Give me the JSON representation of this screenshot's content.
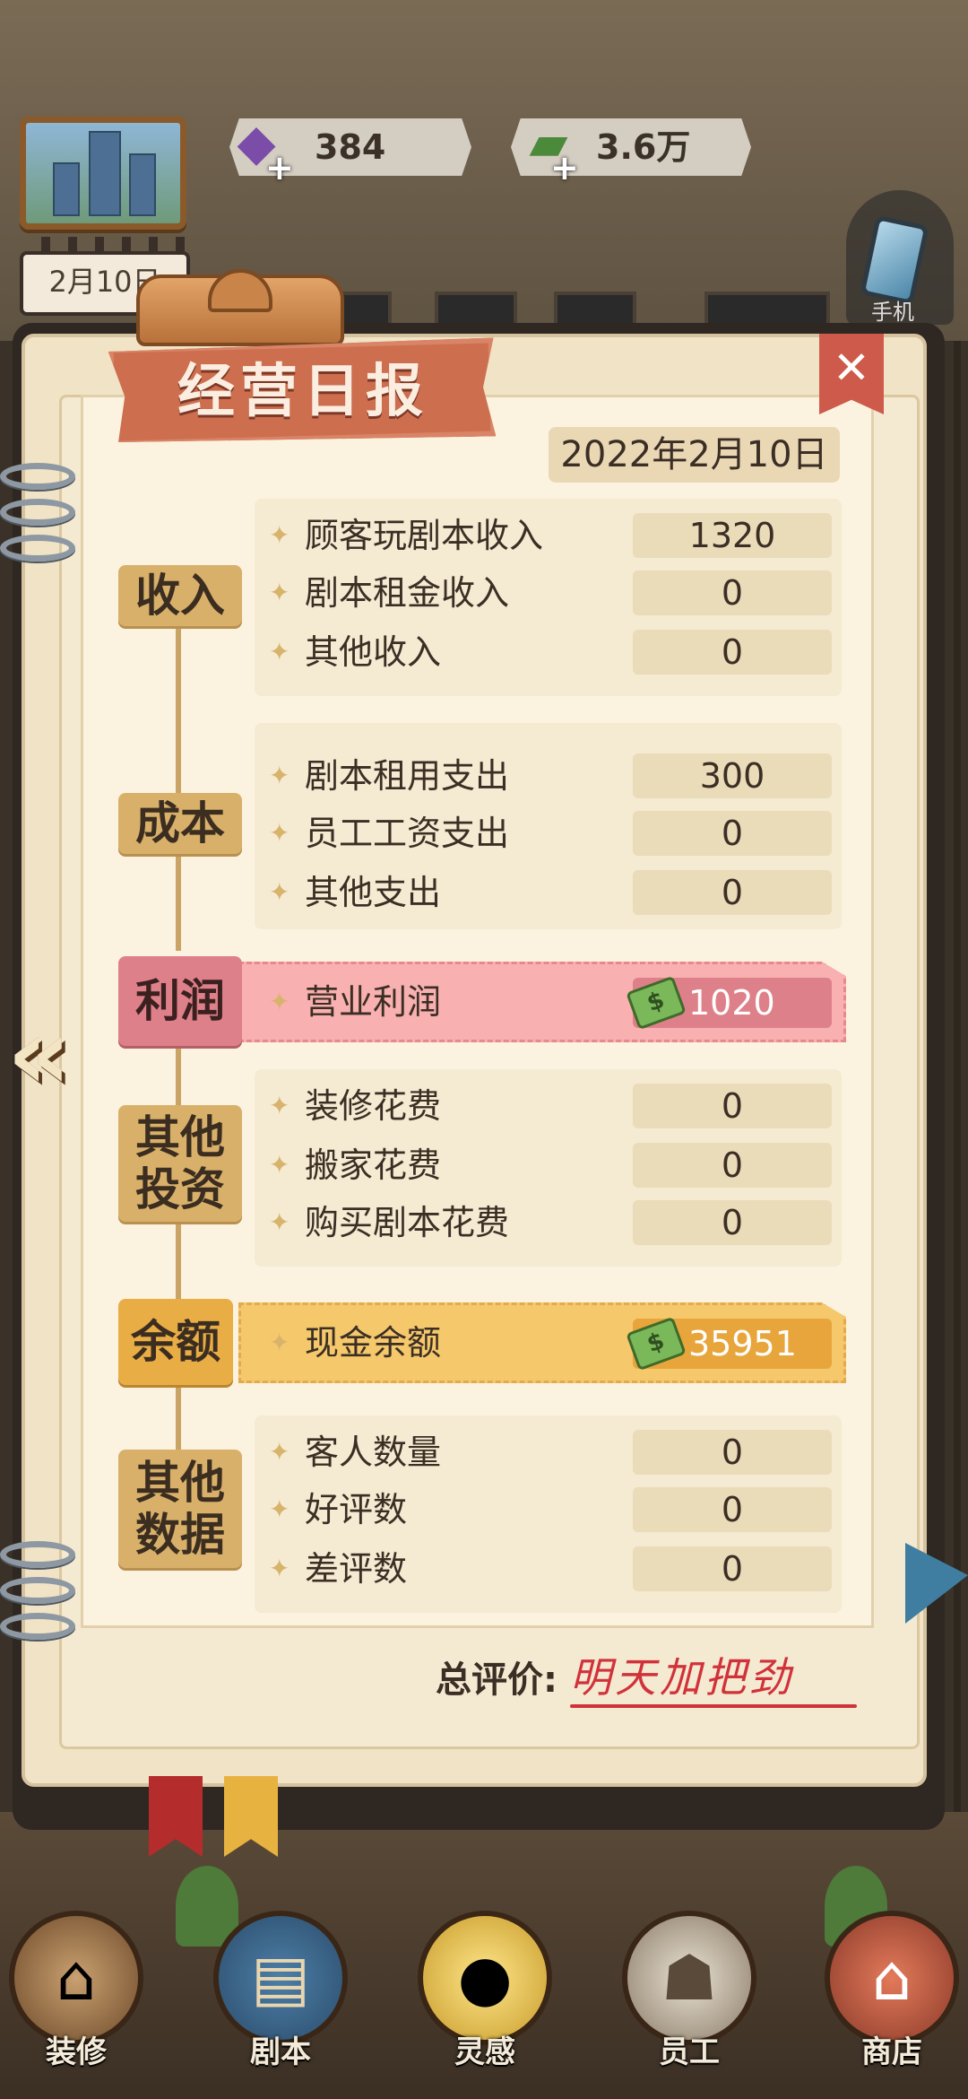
{
  "hud": {
    "gems": "384",
    "cash": "3.6万",
    "calendar_date": "2月10日",
    "phone_label": "手机"
  },
  "report": {
    "title": "经营日报",
    "date": "2022年2月10日",
    "close_icon": "✕",
    "sections": {
      "income": {
        "label": "收入",
        "rows": [
          {
            "label": "顾客玩剧本收入",
            "value": "1320"
          },
          {
            "label": "剧本租金收入",
            "value": "0"
          },
          {
            "label": "其他收入",
            "value": "0"
          }
        ]
      },
      "cost": {
        "label": "成本",
        "rows": [
          {
            "label": "剧本租用支出",
            "value": "300"
          },
          {
            "label": "员工工资支出",
            "value": "0"
          },
          {
            "label": "其他支出",
            "value": "0"
          }
        ]
      },
      "profit": {
        "label": "利润",
        "row": {
          "label": "营业利润",
          "value": "1020"
        }
      },
      "investment": {
        "label_line1": "其他",
        "label_line2": "投资",
        "rows": [
          {
            "label": "装修花费",
            "value": "0"
          },
          {
            "label": "搬家花费",
            "value": "0"
          },
          {
            "label": "购买剧本花费",
            "value": "0"
          }
        ]
      },
      "balance": {
        "label": "余额",
        "row": {
          "label": "现金余额",
          "value": "35951"
        }
      },
      "other_data": {
        "label_line1": "其他",
        "label_line2": "数据",
        "rows": [
          {
            "label": "客人数量",
            "value": "0"
          },
          {
            "label": "好评数",
            "value": "0"
          },
          {
            "label": "差评数",
            "value": "0"
          }
        ]
      }
    },
    "rating_label": "总评价:",
    "rating_value": "明天加把劲"
  },
  "bottom_nav": [
    {
      "label": "装修",
      "icon": "house-icon"
    },
    {
      "label": "剧本",
      "icon": "script-book-icon"
    },
    {
      "label": "灵感",
      "icon": "lightbulb-icon"
    },
    {
      "label": "员工",
      "icon": "staff-badge-icon"
    },
    {
      "label": "商店",
      "icon": "shop-icon"
    }
  ],
  "colors": {
    "profit_bar": "#f8b0b0",
    "balance_bar": "#f6c86c",
    "section_label": "#d8b06a",
    "rating_text": "#d1323a"
  }
}
